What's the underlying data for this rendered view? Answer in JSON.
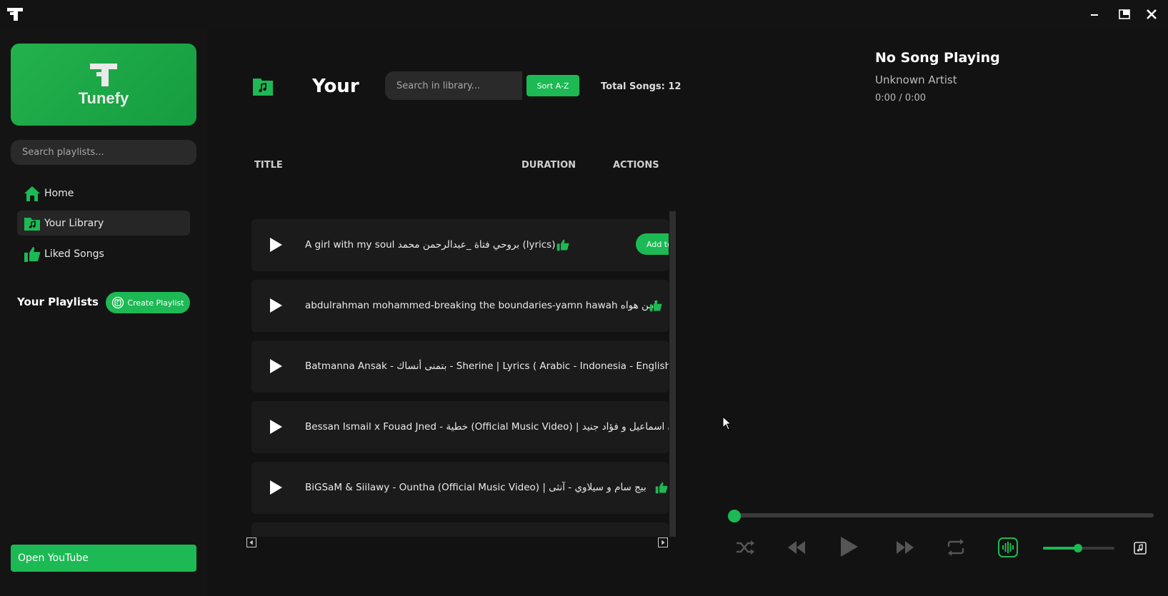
{
  "app": {
    "name": "Tunefy",
    "accent": "#1db954",
    "window_controls": {
      "minimize": "minimize-icon",
      "maximize": "maximize-icon",
      "close": "close-icon"
    }
  },
  "sidebar": {
    "search_placeholder": "Search playlists...",
    "nav": [
      {
        "label": "Home",
        "icon": "home-icon"
      },
      {
        "label": "Your Library",
        "icon": "library-icon",
        "active": true
      },
      {
        "label": "Liked Songs",
        "icon": "thumbs-up-icon"
      }
    ],
    "playlists_heading": "Your Playlists",
    "create_playlist_label": "Create Playlist",
    "open_youtube_label": "Open YouTube"
  },
  "library": {
    "title": "Your",
    "search_placeholder": "Search in library...",
    "sort_label": "Sort A-Z",
    "total_songs": "Total Songs: 12",
    "columns": {
      "title": "TITLE",
      "duration": "DURATION",
      "actions": "ACTIONS"
    },
    "songs": [
      {
        "title": "A girl with my soul بروحي فتاة _عبدالرحمن محمد (lyrics)",
        "add_label": "Add to"
      },
      {
        "title": "abdulrahman mohammed-breaking the boundaries-yamn hawah يامن هواه"
      },
      {
        "title": "Batmanna Ansak - بتمنى أنساك - Sherine | Lyrics ( Arabic - Indonesia - English - L"
      },
      {
        "title": "Bessan Ismail x Fouad Jned - خطية (Official Music Video) | بيسان اسماعيل و فؤاد جنيد"
      },
      {
        "title": "BiGSaM & Siilawy - Ountha (Official Music Video) | بيج سام و سيلاوي - آنثى"
      }
    ]
  },
  "now_playing": {
    "title": "No Song Playing",
    "artist": "Unknown Artist",
    "time": "0:00 / 0:00",
    "progress": 0,
    "volume": 0.5
  }
}
